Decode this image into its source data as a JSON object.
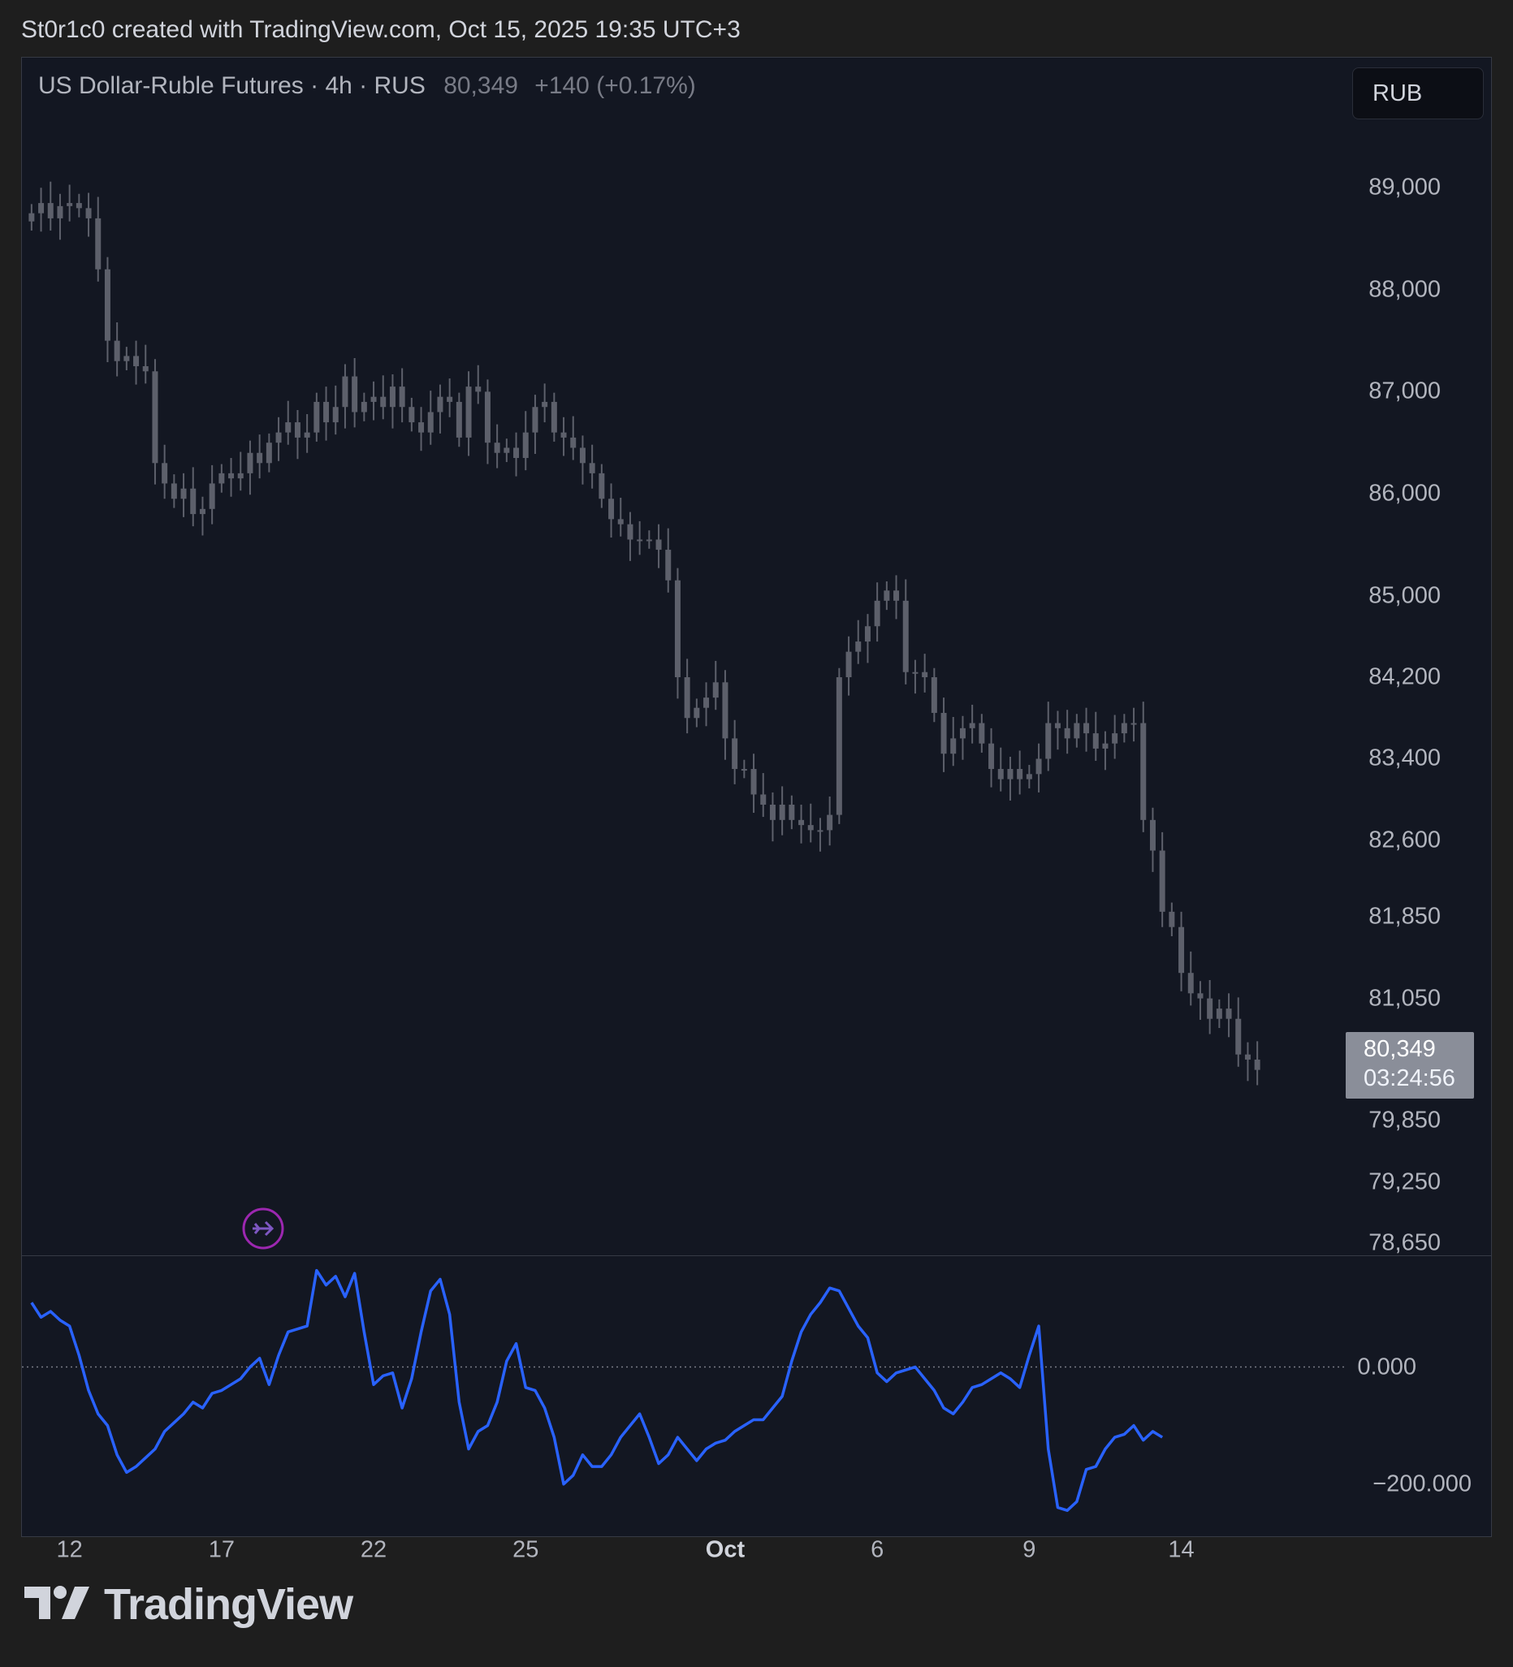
{
  "header": {
    "attribution": "St0r1c0 created with TradingView.com, Oct 15, 2025 19:35 UTC+3"
  },
  "legend": {
    "symbol": "US Dollar-Ruble Futures",
    "interval": "4h",
    "exchange": "RUS",
    "last": "80,349",
    "change": "+140 (+0.17%)"
  },
  "currency_button": "RUB",
  "last_price_tag": {
    "price": "80,349",
    "countdown": "03:24:56"
  },
  "brand": {
    "name": "TradingView"
  },
  "icons": {
    "navigate": "arrow-right-circle-icon",
    "logo": "tradingview-logo-icon"
  },
  "colors": {
    "background": "#131722",
    "candle": "#5d606b",
    "oscillator": "#2962ff",
    "nav_icon": "#9c27b0"
  },
  "chart_data": [
    {
      "type": "candlestick",
      "title": "US Dollar-Ruble Futures · 4h · RUS",
      "ylabel": "RUB",
      "y_tick_labels": [
        "89,000",
        "88,000",
        "87,000",
        "86,000",
        "85,000",
        "84,200",
        "83,400",
        "82,600",
        "81,850",
        "81,050",
        "80,450",
        "79,850",
        "79,250",
        "78,650"
      ],
      "y_tick_values": [
        89000,
        88000,
        87000,
        86000,
        85000,
        84200,
        83400,
        82600,
        81850,
        81050,
        80450,
        79850,
        79250,
        78650
      ],
      "x_tick_labels": [
        "12",
        "17",
        "22",
        "25",
        "Oct",
        "6",
        "9",
        "14"
      ],
      "x_tick_positions": [
        4,
        20,
        36,
        52,
        73,
        89,
        105,
        121
      ],
      "last_value": 80349,
      "close": [
        88750,
        88850,
        88700,
        88820,
        88850,
        88800,
        88700,
        88200,
        87500,
        87300,
        87350,
        87250,
        87200,
        86300,
        86100,
        85950,
        86050,
        85800,
        85850,
        86100,
        86200,
        86150,
        86200,
        86400,
        86300,
        86500,
        86600,
        86700,
        86550,
        86600,
        86900,
        86700,
        86850,
        87150,
        86800,
        86900,
        86950,
        86850,
        87050,
        86850,
        86700,
        86600,
        86800,
        86950,
        86900,
        86550,
        87050,
        87000,
        86500,
        86400,
        86450,
        86350,
        86600,
        86850,
        86900,
        86600,
        86550,
        86450,
        86300,
        86200,
        85950,
        85750,
        85700,
        85550,
        85550,
        85550,
        85450,
        85150,
        84200,
        83800,
        83900,
        84000,
        84150,
        83600,
        83300,
        83300,
        83050,
        82950,
        82800,
        82950,
        82800,
        82750,
        82700,
        82700,
        82850,
        84200,
        84450,
        84550,
        84700,
        84950,
        85050,
        84950,
        84250,
        84250,
        84200,
        83850,
        83450,
        83600,
        83700,
        83750,
        83550,
        83300,
        83200,
        83300,
        83200,
        83250,
        83400,
        83750,
        83700,
        83600,
        83750,
        83650,
        83500,
        83550,
        83650,
        83750,
        83750,
        82800,
        82500,
        81900,
        81750,
        81300,
        81100,
        81050,
        80850,
        80950,
        80850,
        80500,
        80450,
        80349
      ],
      "range": [
        78650,
        89400
      ]
    },
    {
      "type": "line",
      "name": "oscillator",
      "y_tick_labels": [
        "0.000",
        "−200.000"
      ],
      "y_tick_values": [
        0,
        -200
      ],
      "zero_line": true,
      "values": [
        110,
        85,
        95,
        80,
        70,
        20,
        -40,
        -80,
        -100,
        -150,
        -180,
        -170,
        -155,
        -140,
        -110,
        -95,
        -80,
        -60,
        -70,
        -45,
        -40,
        -30,
        -20,
        0,
        15,
        -30,
        20,
        60,
        65,
        70,
        165,
        140,
        155,
        120,
        160,
        60,
        -30,
        -15,
        -10,
        -70,
        -20,
        60,
        130,
        150,
        90,
        -60,
        -140,
        -110,
        -100,
        -60,
        10,
        40,
        -35,
        -40,
        -70,
        -120,
        -200,
        -185,
        -150,
        -170,
        -170,
        -150,
        -120,
        -100,
        -80,
        -120,
        -165,
        -150,
        -120,
        -140,
        -160,
        -140,
        -130,
        -125,
        -110,
        -100,
        -90,
        -90,
        -70,
        -50,
        10,
        60,
        90,
        110,
        135,
        130,
        100,
        70,
        50,
        -10,
        -25,
        -10,
        -5,
        0,
        -20,
        -40,
        -70,
        -80,
        -60,
        -35,
        -30,
        -20,
        -10,
        -20,
        -35,
        20,
        70,
        -140,
        -240,
        -245,
        -230,
        -175,
        -170,
        -140,
        -120,
        -115,
        -100,
        -125,
        -110,
        -120
      ],
      "range": [
        -260,
        170
      ]
    }
  ]
}
